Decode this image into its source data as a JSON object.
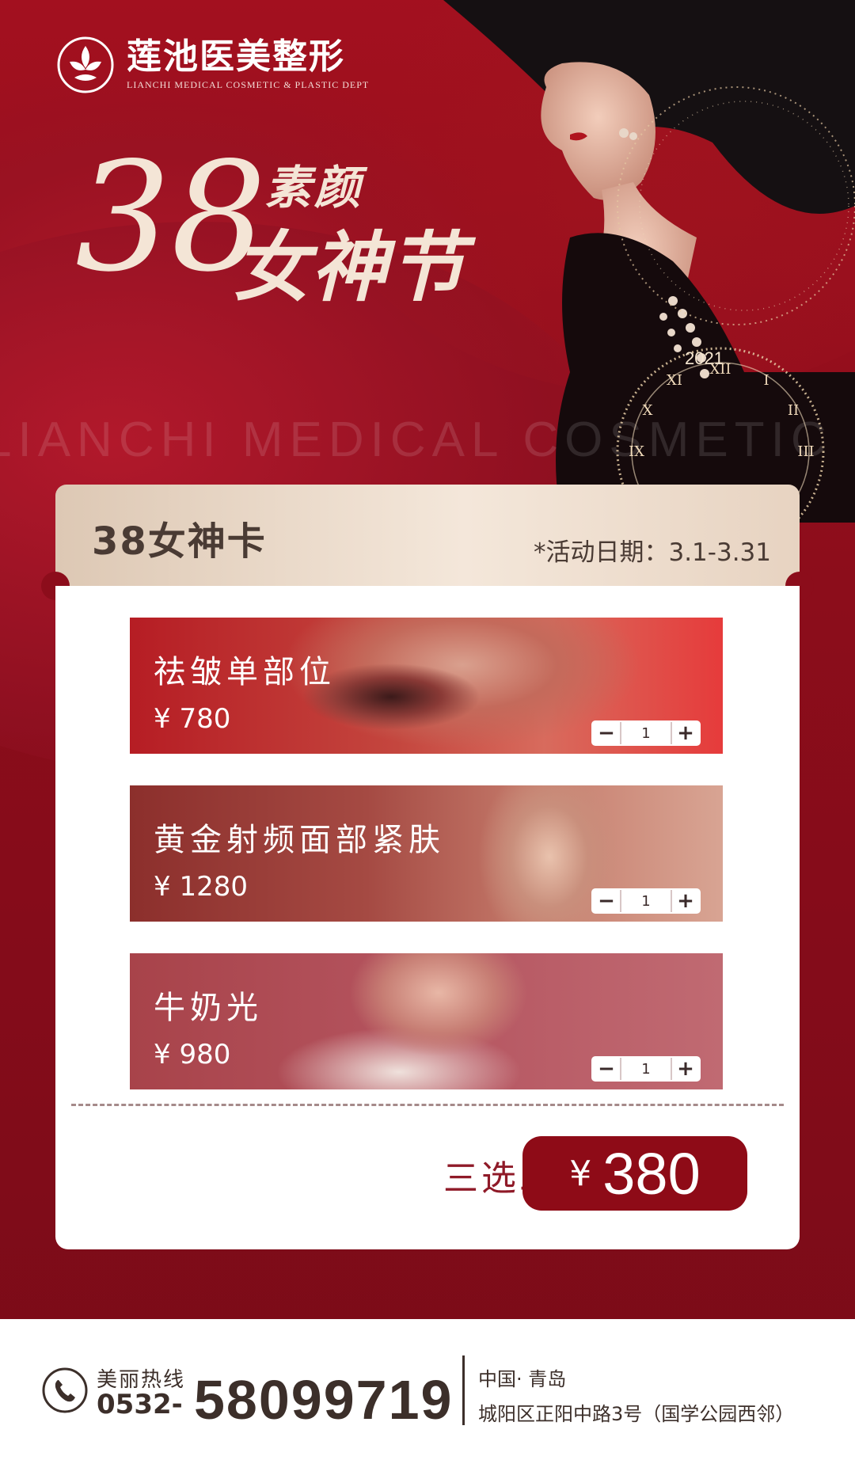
{
  "brand": {
    "name_cn": "莲池医美整形",
    "name_en": "LIANCHI MEDICAL COSMETIC & PLASTIC DEPT"
  },
  "hero": {
    "number": "38",
    "title_top": "素颜",
    "title_bottom": "女神节",
    "year": "2021",
    "watermark": "LIANCHI MEDICAL COSMETIC"
  },
  "card": {
    "title": "38女神卡",
    "date": "*活动日期：3.1-3.31",
    "items": [
      {
        "name": "祛皱单部位",
        "price": "¥ 780",
        "qty": "1"
      },
      {
        "name": "黄金射频面部紧肤",
        "price": "¥ 1280",
        "qty": "1"
      },
      {
        "name": "牛奶光",
        "price": "¥ 980",
        "qty": "1"
      }
    ],
    "stepper": {
      "minus": "−",
      "plus": "+"
    },
    "deal_label": "三选二",
    "deal_yen": "¥",
    "deal_price": "380"
  },
  "footer": {
    "hotline_label": "美丽热线",
    "area_code": "0532-",
    "phone": "58099719",
    "address_line1": "中国· 青岛",
    "address_line2": "城阳区正阳中路3号（国学公园西邻）"
  },
  "colors": {
    "primary": "#8e0b17",
    "gold": "#e6d2bf",
    "text_dark": "#3c2f2a"
  }
}
